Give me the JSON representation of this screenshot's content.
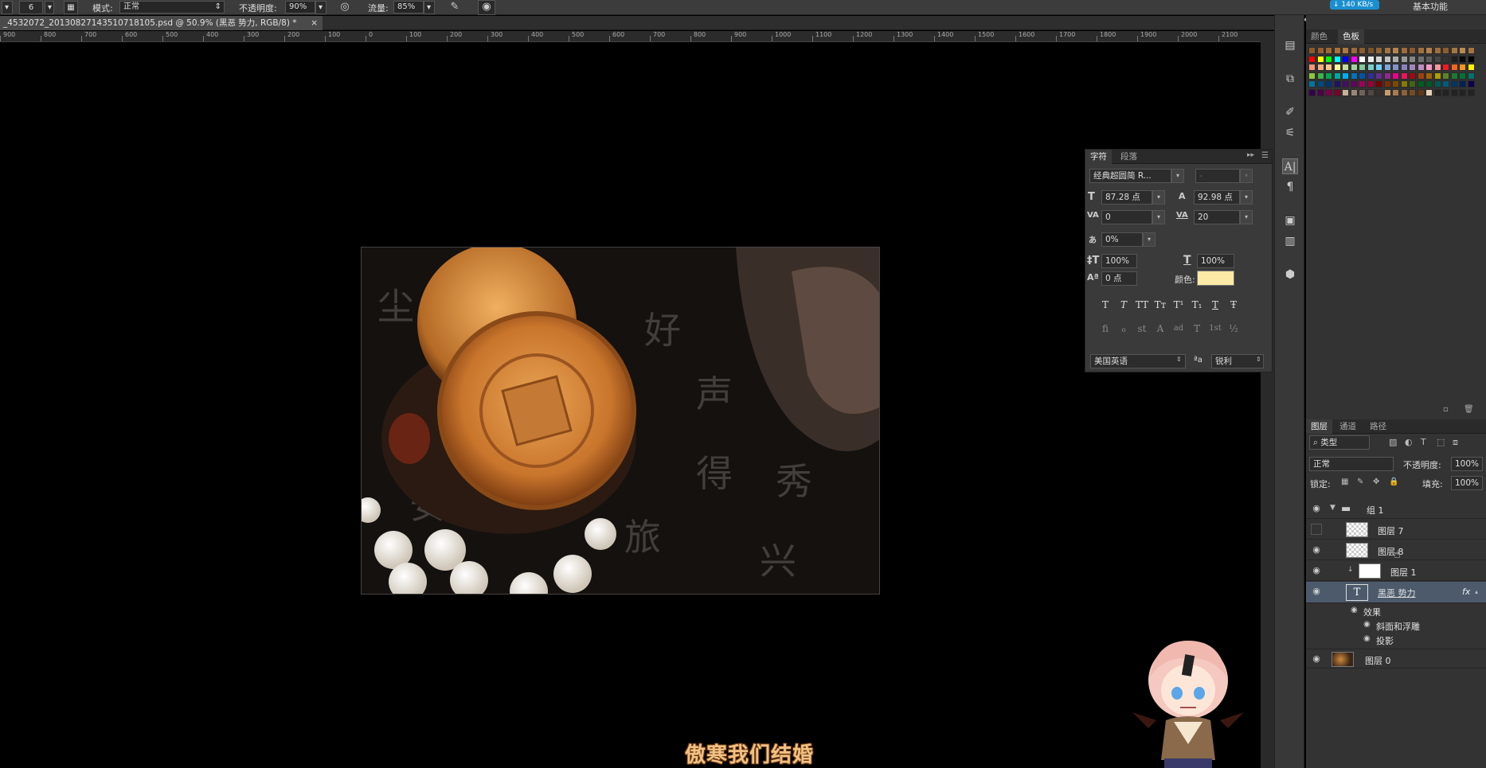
{
  "options_bar": {
    "brush_size": "6",
    "mode_label": "模式:",
    "mode_value": "正常",
    "opacity_label": "不透明度:",
    "opacity_value": "90%",
    "flow_label": "流量:",
    "flow_value": "85%",
    "net_speed": "↓ 140 KB/s",
    "workspace": "基本功能"
  },
  "document_tab": {
    "title": "_4532072_20130827143510718105.psd @ 50.9% (黑恶 势力, RGB/8) *",
    "close": "×"
  },
  "ruler": {
    "labels": [
      "900",
      "800",
      "700",
      "600",
      "500",
      "400",
      "300",
      "200",
      "100",
      "0",
      "100",
      "200",
      "300",
      "400",
      "500",
      "600",
      "700",
      "800",
      "900",
      "1000",
      "1100",
      "1200",
      "1300",
      "1400",
      "1500",
      "1600",
      "1700",
      "1800",
      "1900",
      "2000",
      "2100"
    ]
  },
  "swatch_panel": {
    "tabs": [
      "颜色",
      "色板"
    ],
    "active_tab": "色板"
  },
  "character_panel": {
    "tabs": [
      "字符",
      "段落"
    ],
    "font_family": "经典超圆简 R...",
    "font_style": "-",
    "font_size": "87.28 点",
    "leading": "92.98 点",
    "kerning": "0",
    "tracking": "20",
    "tsume": "0%",
    "vertical_scale": "100%",
    "horizontal_scale": "100%",
    "baseline_shift": "0 点",
    "color_label": "颜色:",
    "text_color": "#fdeaa6",
    "style_buttons": [
      "T",
      "T",
      "TT",
      "Tт",
      "T¹",
      "T₁",
      "T",
      "Ŧ"
    ],
    "opentype_buttons": [
      "fi",
      "ℴ",
      "st",
      "A",
      "ad",
      "T",
      "1st",
      "½"
    ],
    "language": "美国英语",
    "aa_label": "ªa",
    "antialias": "锐利"
  },
  "layers_panel": {
    "tabs": [
      "图层",
      "通道",
      "路径"
    ],
    "filter_kind": "类型",
    "blend_mode": "正常",
    "opacity_label": "不透明度:",
    "opacity_value": "100%",
    "lock_label": "锁定:",
    "fill_label": "填充:",
    "fill_value": "100%",
    "layers": [
      {
        "name": "组 1"
      },
      {
        "name": "图层 7"
      },
      {
        "name": "图层 8"
      },
      {
        "name": "图层 1"
      },
      {
        "name": "黑恶 势力",
        "fx": "fx"
      },
      {
        "name": "效果"
      },
      {
        "name": "斜面和浮雕"
      },
      {
        "name": "投影"
      },
      {
        "name": "图层 0"
      }
    ]
  },
  "subtitle": "傲寒我们结婚"
}
